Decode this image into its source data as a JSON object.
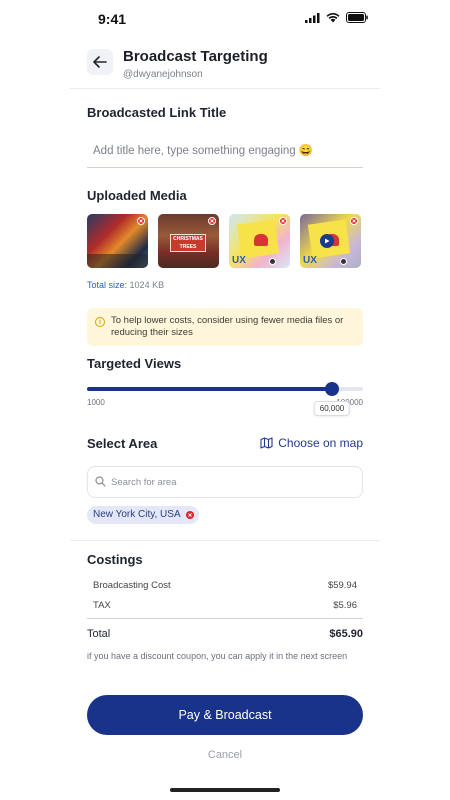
{
  "status_bar": {
    "time": "9:41"
  },
  "header": {
    "title": "Broadcast Targeting",
    "handle": "@dwyanejohnson"
  },
  "link_title": {
    "label": "Broadcasted Link Title",
    "placeholder": "Add title here, type something engaging 😄"
  },
  "media": {
    "label": "Uploaded Media",
    "items": [
      {
        "icon": "street-photo"
      },
      {
        "icon": "christmas-trees-photo",
        "sign_text": "CHRISTMAS TREES"
      },
      {
        "icon": "ux-card-photo",
        "text": "UX"
      },
      {
        "icon": "ux-card-video",
        "text": "UX"
      }
    ],
    "total_prefix": "Total size:",
    "total_value": "1024 KB"
  },
  "tip": {
    "text": "To help lower costs, consider using fewer media files or reducing their sizes"
  },
  "targeted_views": {
    "label": "Targeted Views",
    "min_label": "1000",
    "max_label": "100000",
    "min": 1000,
    "max": 100000,
    "value": 60000,
    "value_label": "60,000"
  },
  "area": {
    "label": "Select Area",
    "map_link": "Choose on map",
    "search_placeholder": "Search for area",
    "selected": [
      "New York City, USA"
    ]
  },
  "costings": {
    "label": "Costings",
    "items": [
      {
        "name": "Broadcasting Cost",
        "amount": "$59.94"
      },
      {
        "name": "TAX",
        "amount": "$5.96"
      }
    ],
    "total_label": "Total",
    "total_amount": "$65.90",
    "note": "if you have a discount coupon, you can apply it in the next screen"
  },
  "actions": {
    "pay_label": "Pay & Broadcast",
    "cancel_label": "Cancel"
  },
  "colors": {
    "primary": "#19328a",
    "danger": "#e02424",
    "tip_bg": "#fff6dc"
  }
}
